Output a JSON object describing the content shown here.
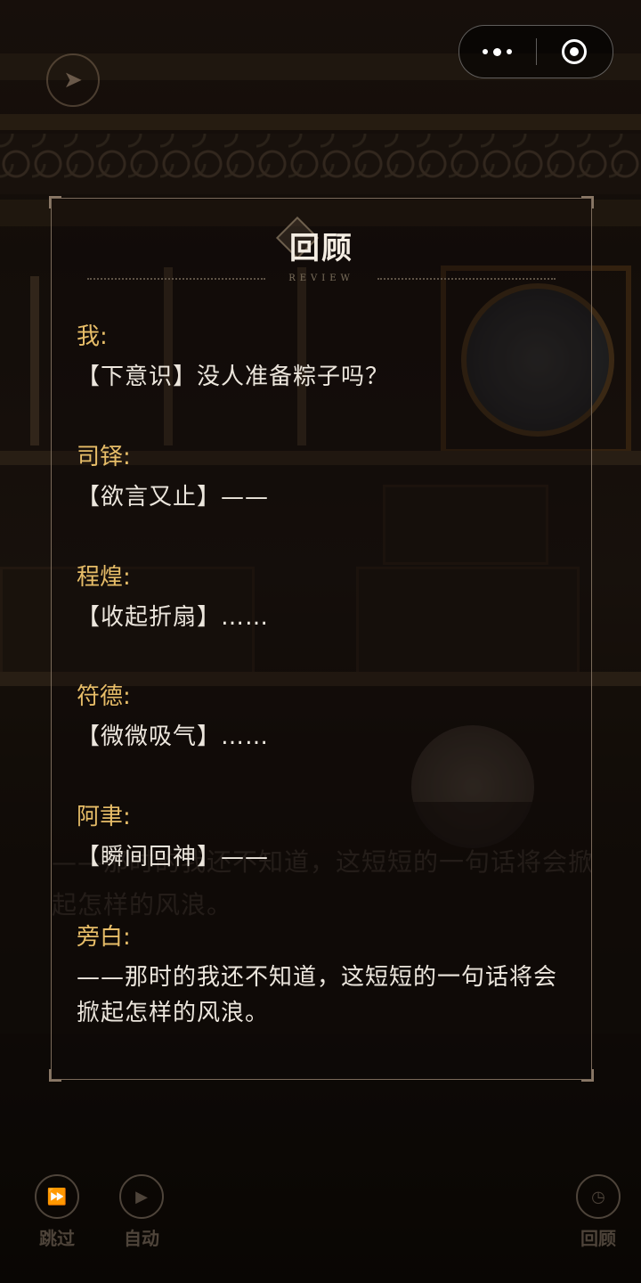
{
  "panel": {
    "title": "回顾",
    "subtitle": "REVIEW"
  },
  "entries": [
    {
      "speaker": "我:",
      "text": "【下意识】没人准备粽子吗？"
    },
    {
      "speaker": "司铎:",
      "text": "【欲言又止】——"
    },
    {
      "speaker": "程煌:",
      "text": "【收起折扇】……"
    },
    {
      "speaker": "符德:",
      "text": "【微微吸气】……"
    },
    {
      "speaker": "阿聿:",
      "text": "【瞬间回神】——"
    },
    {
      "speaker": "旁白:",
      "text": "——那时的我还不知道，这短短的一句话将会掀起怎样的风浪。"
    }
  ],
  "background_dialog": "——那时的我还不知道，这短短的一句话将会掀起怎样的风浪。",
  "controls": {
    "skip_label": "跳过",
    "auto_label": "自动",
    "review_label": "回顾"
  },
  "icons": {
    "back": "back-arrow-icon",
    "menu": "more-dots-icon",
    "close": "target-icon",
    "skip": "fast-forward-icon",
    "auto": "play-icon",
    "review": "clock-icon"
  },
  "colors": {
    "speaker": "#e7bd68",
    "text": "#ece6dd",
    "panel_border": "#7a6a5a"
  }
}
